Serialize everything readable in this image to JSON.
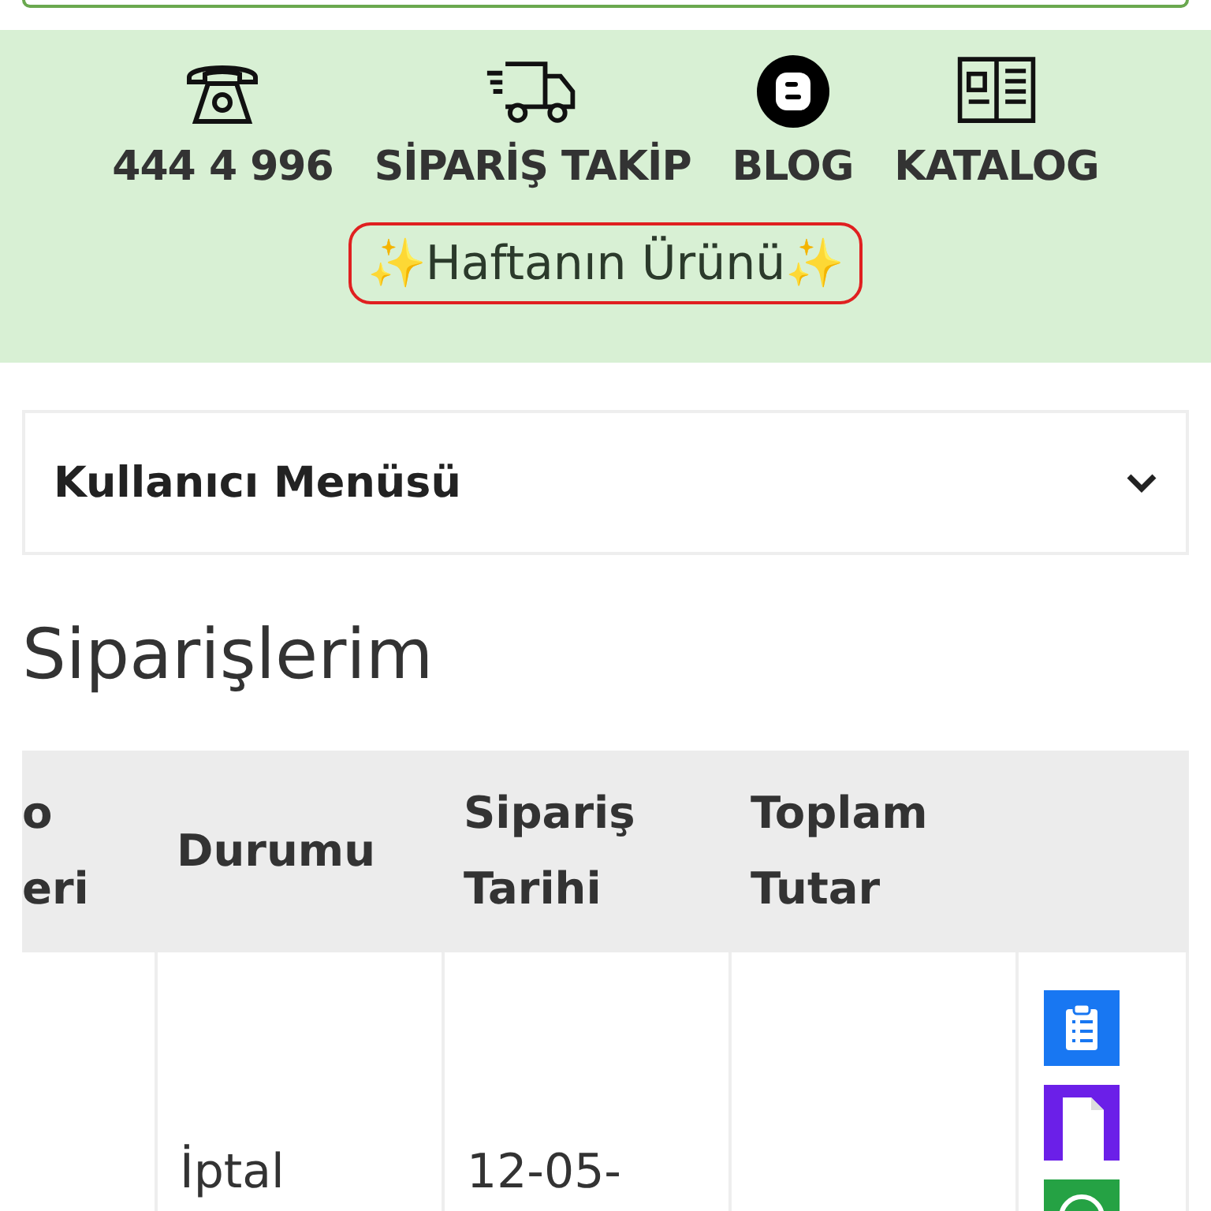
{
  "quick_links": [
    {
      "kind": "phone",
      "label": "444 4 996"
    },
    {
      "kind": "truck",
      "label": "SİPARİŞ TAKİP"
    },
    {
      "kind": "blog",
      "label": "BLOG"
    },
    {
      "kind": "book",
      "label": "KATALOG"
    }
  ],
  "featured_button": {
    "label": "✨Haftanın Ürünü✨"
  },
  "user_menu": {
    "title": "Kullanıcı Menüsü",
    "expanded": false
  },
  "page_title": "Siparişlerim",
  "table": {
    "columns": [
      {
        "lines": [
          "o",
          "eri"
        ]
      },
      {
        "lines": [
          "Durumu"
        ]
      },
      {
        "lines": [
          "Sipariş",
          "Tarihi"
        ]
      },
      {
        "lines": [
          "Toplam",
          "Tutar"
        ]
      },
      {}
    ],
    "rows": [
      {
        "cells": [
          null,
          "İptal",
          "12-05-",
          null
        ],
        "actions": [
          {
            "kind": "details",
            "color": "#1877f2"
          },
          {
            "kind": "document",
            "color": "#6b1fe8"
          },
          {
            "kind": "whatsapp",
            "color": "#25a244"
          }
        ]
      }
    ]
  }
}
